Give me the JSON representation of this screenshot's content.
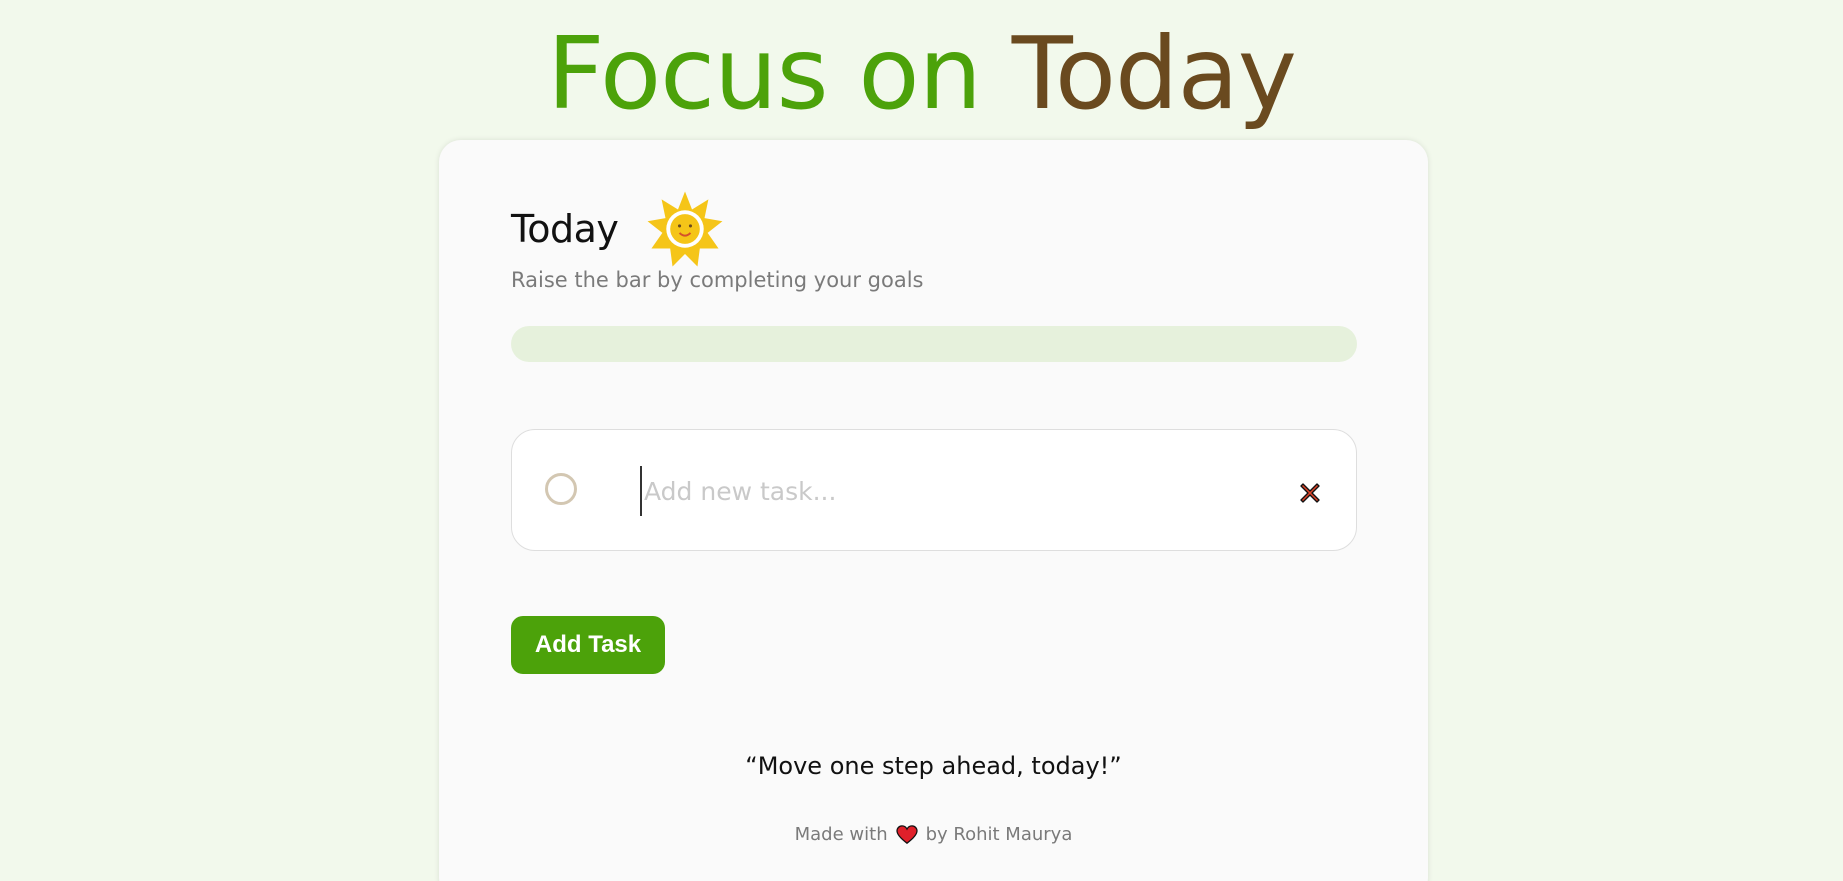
{
  "header": {
    "title_part1": "Focus on",
    "title_part2": "Today"
  },
  "card": {
    "title": "Today",
    "subtitle": "Raise the bar by completing your goals",
    "progress": {
      "completed_fraction": 0
    },
    "task_input": {
      "value": "",
      "placeholder": "Add new task..."
    },
    "add_button_label": "Add Task",
    "quote": "“Move one step ahead, today!”",
    "footer": {
      "made_with": "Made with",
      "by": "by Rohit Maurya"
    }
  },
  "icons": {
    "sun": "sun-icon",
    "checkbox": "circle-checkbox-icon",
    "delete": "close-x-icon",
    "heart": "heart-icon"
  },
  "colors": {
    "background": "#f2f9ec",
    "accent_green": "#4ca20a",
    "accent_brown": "#6a4a1f",
    "progress_track": "#e6f1dc",
    "heart_red": "#e0202a"
  }
}
